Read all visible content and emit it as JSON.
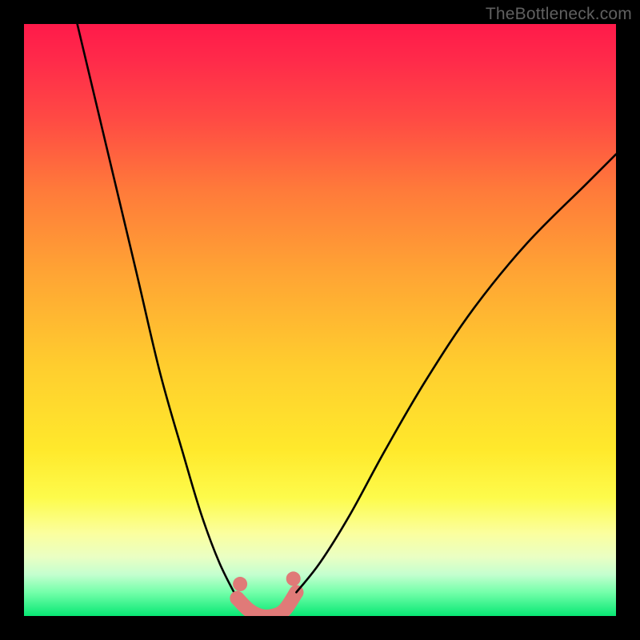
{
  "watermark": {
    "text": "TheBottleneck.com"
  },
  "chart_data": {
    "type": "line",
    "title": "",
    "xlabel": "",
    "ylabel": "",
    "xlim": [
      0,
      100
    ],
    "ylim": [
      0,
      100
    ],
    "grid": false,
    "series": [
      {
        "name": "bottleneck-curve-left",
        "stroke": "#000000",
        "x": [
          9,
          14,
          19,
          23,
          27,
          30,
          33,
          36
        ],
        "y": [
          100,
          79,
          58,
          41,
          27,
          17,
          9,
          3
        ]
      },
      {
        "name": "highlight-band",
        "stroke": "#e07a78",
        "x": [
          36,
          38,
          40,
          42,
          44,
          46
        ],
        "y": [
          3,
          1,
          0,
          0,
          1,
          4
        ]
      },
      {
        "name": "bottleneck-curve-right",
        "stroke": "#000000",
        "x": [
          46,
          50,
          55,
          61,
          68,
          76,
          85,
          95,
          100
        ],
        "y": [
          4,
          9,
          17,
          28,
          40,
          52,
          63,
          73,
          78
        ]
      }
    ],
    "background": {
      "type": "vertical-gradient",
      "stops": [
        {
          "pos": 0.0,
          "color": "#ff1a4a"
        },
        {
          "pos": 0.16,
          "color": "#ff4a44"
        },
        {
          "pos": 0.42,
          "color": "#ffa434"
        },
        {
          "pos": 0.72,
          "color": "#ffe92c"
        },
        {
          "pos": 0.9,
          "color": "#eaffc3"
        },
        {
          "pos": 1.0,
          "color": "#08e874"
        }
      ]
    }
  }
}
